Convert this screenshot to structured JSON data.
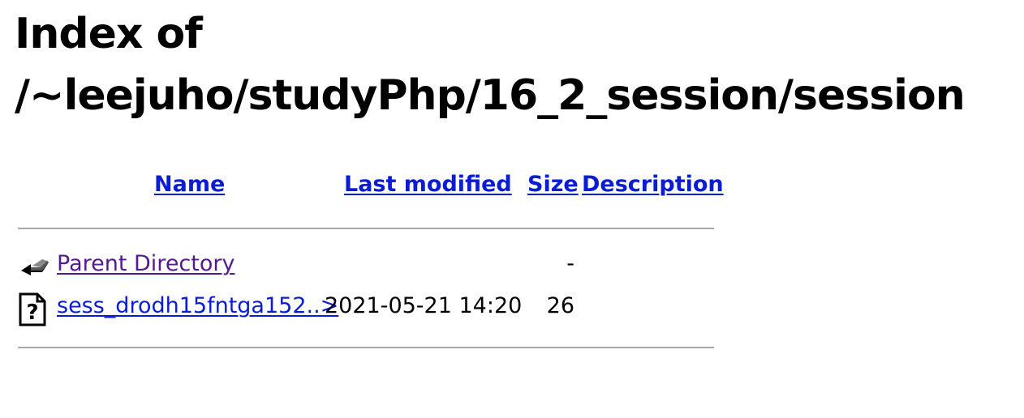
{
  "page": {
    "title": "Index of /~leejuho/studyPhp/16_2_session/session"
  },
  "columns": {
    "name": "Name",
    "last_modified": "Last modified",
    "size": "Size",
    "description": "Description"
  },
  "entries": [
    {
      "icon": "back-icon",
      "name": "Parent Directory",
      "last_modified": "",
      "size": "-",
      "description": "",
      "visited": true
    },
    {
      "icon": "unknown-file-icon",
      "name": "sess_drodh15fntga152..>",
      "last_modified": "2021-05-21 14:20",
      "size": "26",
      "description": "",
      "visited": false
    }
  ],
  "colors": {
    "link": "#0a1cd4",
    "visited_link": "#551a8b",
    "rule": "#a8a8a8"
  }
}
